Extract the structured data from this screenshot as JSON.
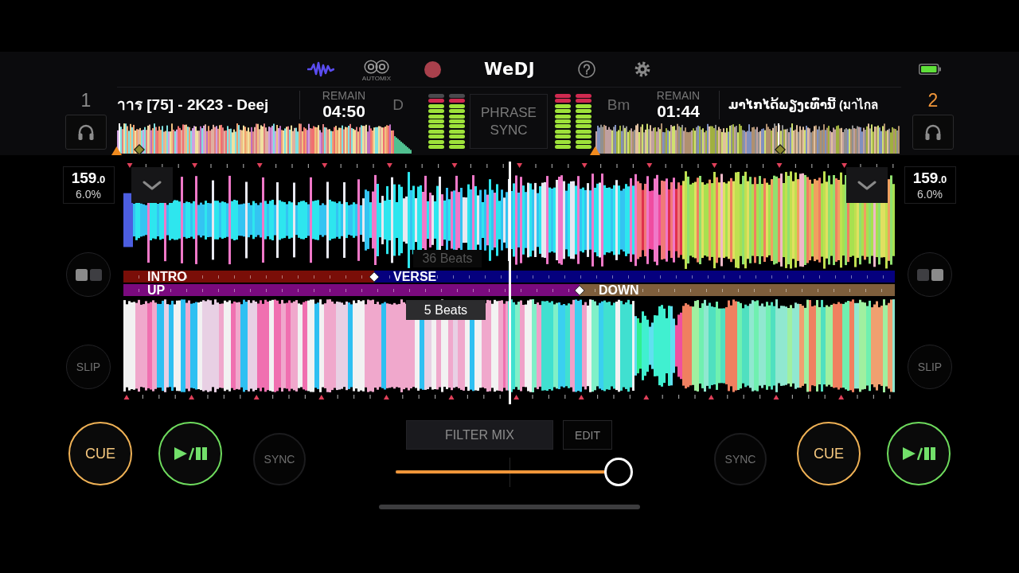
{
  "toolbar": {
    "automix_label": "AUTOMIX",
    "logo": "WeDJ"
  },
  "phrase_sync_button": "PHRASE SYNC",
  "decks": [
    {
      "number": "1",
      "master": false,
      "title": "าาร [75] - 2K23 - Deej",
      "remain_label": "REMAIN",
      "remain": "04:50",
      "key": "D",
      "meters": [
        {
          "level": 0.91
        },
        {
          "level": 0.91
        }
      ],
      "bpm": "159",
      "bpm_decimal": ".0",
      "pitch": "6.0%",
      "beat_label": {
        "text": "36 Beats",
        "dimmed": true
      },
      "phrases": [
        {
          "label": "INTRO",
          "color": "#7a0e08"
        },
        {
          "label": "VERSE",
          "color": "#05007e"
        }
      ],
      "slip": "SLIP",
      "cue": "CUE",
      "sync": "SYNC"
    },
    {
      "number": "2",
      "master": true,
      "title": "ມາໄກໄດ້ພຽງເທົ່ານີ້ (มาไกล",
      "remain_label": "REMAIN",
      "remain": "01:44",
      "key": "Bm",
      "meters": [
        {
          "level": 1
        },
        {
          "level": 1
        }
      ],
      "bpm": "159",
      "bpm_decimal": ".0",
      "pitch": "6.0%",
      "beat_label": {
        "text": "5 Beats",
        "dimmed": false
      },
      "phrases": [
        {
          "label": "UP",
          "color": "#7a0a7e"
        },
        {
          "label": "DOWN",
          "color": "#7e5e3c"
        }
      ],
      "slip": "SLIP",
      "cue": "CUE",
      "sync": "SYNC"
    }
  ],
  "mixer": {
    "filter_mix": "FILTER MIX",
    "edit": "EDIT",
    "crossfader": {
      "level": 0.94
    }
  }
}
